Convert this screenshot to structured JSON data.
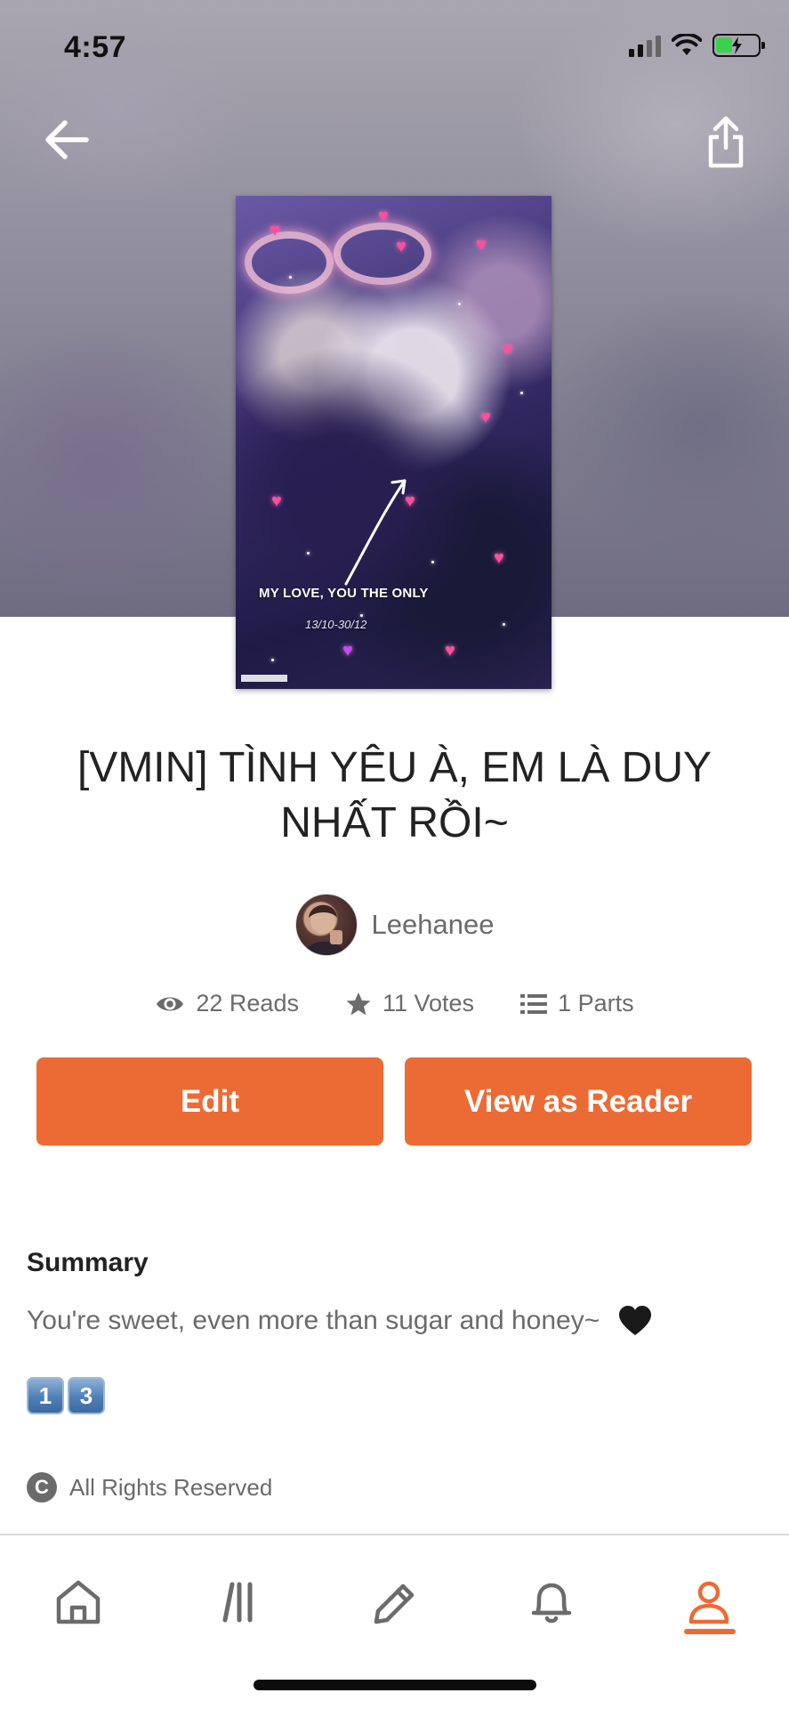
{
  "status_bar": {
    "time": "4:57"
  },
  "header": {
    "back_icon": "arrow-left-icon",
    "share_icon": "share-icon"
  },
  "cover": {
    "caption": "MY LOVE, YOU THE ONLY",
    "date_text": "13/10-30/12"
  },
  "story": {
    "title": "[VMIN] TÌNH YÊU À, EM LÀ DUY NHẤT RỒI~",
    "author": "Leehanee"
  },
  "stats": {
    "reads": "22 Reads",
    "votes": "11 Votes",
    "parts": "1 Parts"
  },
  "actions": {
    "edit_label": "Edit",
    "reader_label": "View as Reader"
  },
  "summary": {
    "heading": "Summary",
    "text": "You're sweet, even more than sugar and honey~",
    "emoji": "🖤",
    "keycaps": [
      "1",
      "3"
    ]
  },
  "rights": {
    "label": "All Rights Reserved"
  },
  "bottom_nav": {
    "items": [
      {
        "name": "home",
        "icon": "home-icon"
      },
      {
        "name": "library",
        "icon": "library-icon"
      },
      {
        "name": "write",
        "icon": "pencil-icon"
      },
      {
        "name": "notifications",
        "icon": "bell-icon"
      },
      {
        "name": "profile",
        "icon": "person-icon",
        "active": true
      }
    ]
  },
  "colors": {
    "accent": "#ec6b35",
    "text_primary": "#222222",
    "text_secondary": "#6b6b6b"
  }
}
